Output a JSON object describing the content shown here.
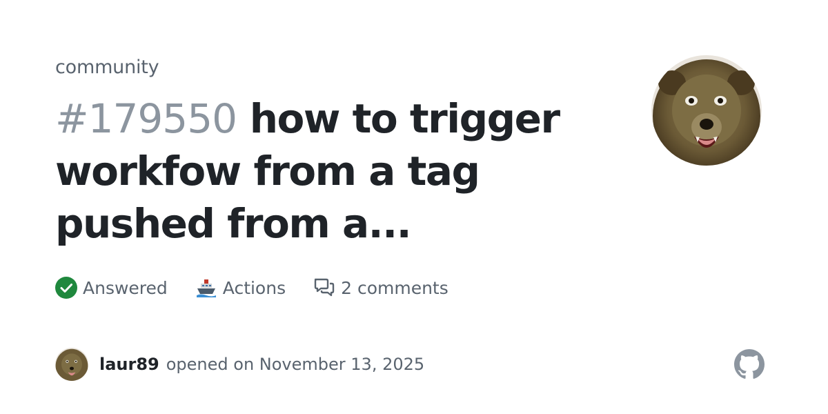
{
  "repo": {
    "name": "community"
  },
  "discussion": {
    "number": "#179550",
    "title": "how to trigger workfow from a tag pushed from a..."
  },
  "meta": {
    "status": {
      "label": "Answered",
      "icon": "check-circle-icon",
      "color": "#1f883d"
    },
    "category": {
      "label": "Actions",
      "icon": "ship-emoji-icon"
    },
    "comments": {
      "label": "2 comments",
      "icon": "comment-discussion-icon"
    }
  },
  "footer": {
    "author": "laur89",
    "opened_text": "opened on November 13, 2025",
    "logo_icon": "github-logo-icon"
  },
  "avatar": {
    "description_icon": "bear-avatar"
  }
}
